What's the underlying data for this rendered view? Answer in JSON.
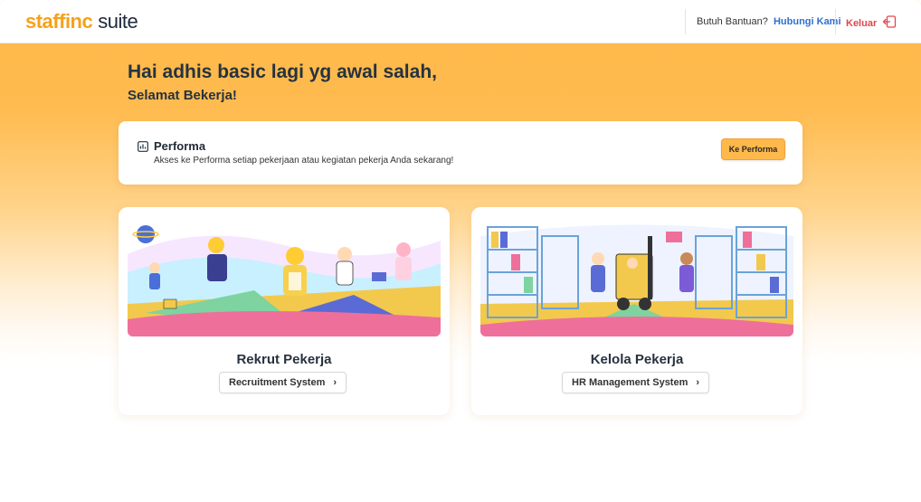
{
  "header": {
    "logo_part1": "staffinc",
    "logo_part2": "suite",
    "help_text": "Butuh Bantuan?",
    "help_link": "Hubungi Kami",
    "logout_label": "Keluar",
    "logout_icon": "logout-icon"
  },
  "greeting": {
    "title": "Hai adhis basic lagi yg awal salah,",
    "subtitle": "Selamat Bekerja!"
  },
  "performa": {
    "icon": "chart-icon",
    "title": "Performa",
    "description": "Akses ke Performa setiap pekerjaan atau kegiatan pekerja Anda sekarang!",
    "button_label": "Ke Performa"
  },
  "modules": [
    {
      "title": "Rekrut Pekerja",
      "button_label": "Recruitment System",
      "illustration": "recruitment-illustration"
    },
    {
      "title": "Kelola Pekerja",
      "button_label": "HR Management System",
      "illustration": "warehouse-illustration"
    }
  ],
  "colors": {
    "brand_orange": "#f5a11a",
    "accent_blue": "#2f6fd1",
    "logout_red": "#e2454b",
    "hero_gradient": "#ffb84a"
  }
}
